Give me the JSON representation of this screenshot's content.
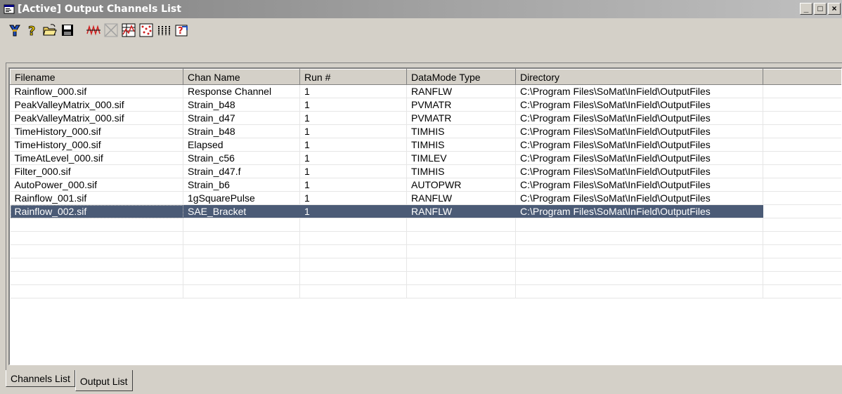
{
  "window": {
    "title": "[Active] Output Channels List",
    "buttons": {
      "minimize": "_",
      "maximize": "□",
      "close": "×"
    }
  },
  "toolbar": {
    "icons": [
      "tools-icon",
      "help-icon",
      "open-folder-icon",
      "save-icon",
      "waveform-icon",
      "delete-icon",
      "data-grid-icon",
      "scatter-icon",
      "columns-icon",
      "export-icon"
    ]
  },
  "table": {
    "columns": [
      "Filename",
      "Chan Name",
      "Run #",
      "DataMode Type",
      "Directory",
      ""
    ],
    "rows": [
      [
        "Rainflow_000.sif",
        "Response Channel",
        "1",
        "RANFLW",
        "C:\\Program Files\\SoMat\\InField\\OutputFiles"
      ],
      [
        "PeakValleyMatrix_000.sif",
        "Strain_b48",
        "1",
        "PVMATR",
        "C:\\Program Files\\SoMat\\InField\\OutputFiles"
      ],
      [
        "PeakValleyMatrix_000.sif",
        "Strain_d47",
        "1",
        "PVMATR",
        "C:\\Program Files\\SoMat\\InField\\OutputFiles"
      ],
      [
        "TimeHistory_000.sif",
        "Strain_b48",
        "1",
        "TIMHIS",
        "C:\\Program Files\\SoMat\\InField\\OutputFiles"
      ],
      [
        "TimeHistory_000.sif",
        "Elapsed",
        "1",
        "TIMHIS",
        "C:\\Program Files\\SoMat\\InField\\OutputFiles"
      ],
      [
        "TimeAtLevel_000.sif",
        "Strain_c56",
        "1",
        "TIMLEV",
        "C:\\Program Files\\SoMat\\InField\\OutputFiles"
      ],
      [
        "Filter_000.sif",
        "Strain_d47.f",
        "1",
        "TIMHIS",
        "C:\\Program Files\\SoMat\\InField\\OutputFiles"
      ],
      [
        "AutoPower_000.sif",
        "Strain_b6",
        "1",
        "AUTOPWR",
        "C:\\Program Files\\SoMat\\InField\\OutputFiles"
      ],
      [
        "Rainflow_001.sif",
        "1gSquarePulse",
        "1",
        "RANFLW",
        "C:\\Program Files\\SoMat\\InField\\OutputFiles"
      ],
      [
        "Rainflow_002.sif",
        "SAE_Bracket",
        "1",
        "RANFLW",
        "C:\\Program Files\\SoMat\\InField\\OutputFiles"
      ]
    ],
    "selected_row": 9
  },
  "tabs": [
    "Channels List",
    "Output List"
  ],
  "active_tab": 1,
  "colors": {
    "selection": "#4b5b76",
    "face": "#d4d0c8"
  }
}
